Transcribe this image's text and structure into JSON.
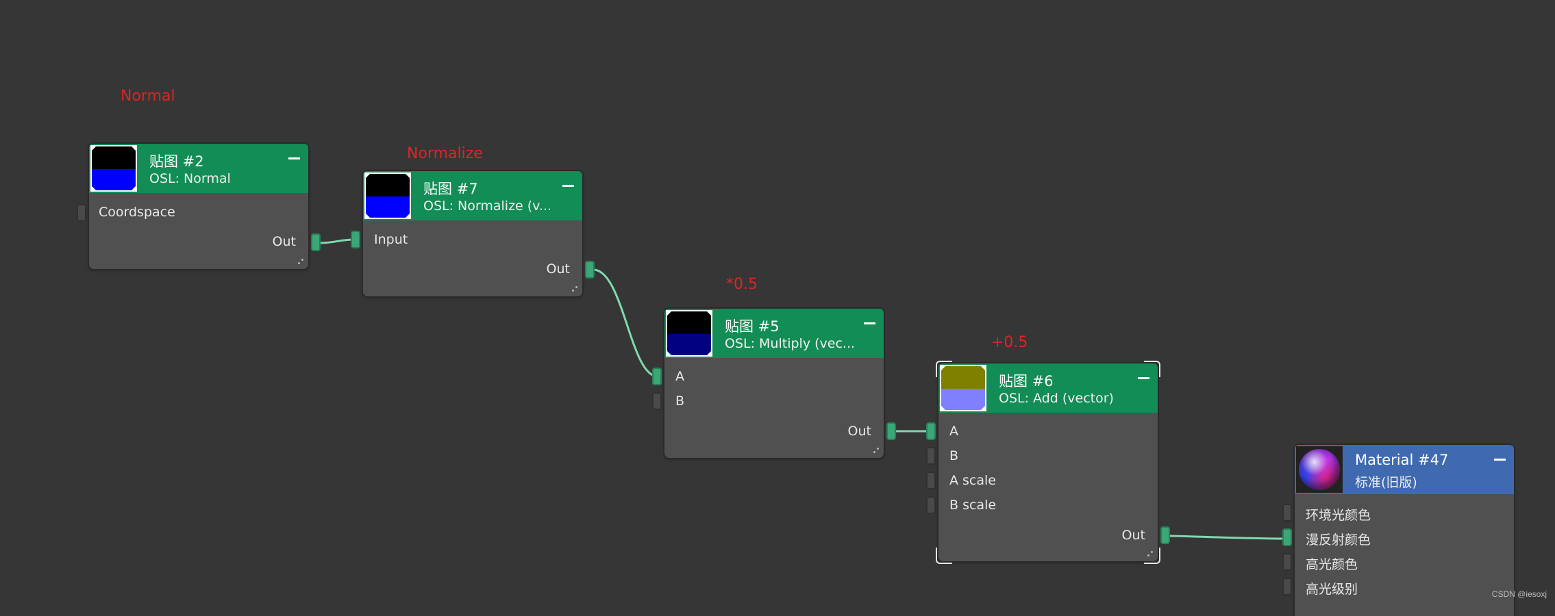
{
  "annotations": {
    "normal": "Normal",
    "normalize": "Normalize",
    "multiply": "*0.5",
    "add": "+0.5"
  },
  "nodes": {
    "map2": {
      "title": "贴图 #2",
      "subtitle": "OSL: Normal",
      "inputs": [
        "Coordspace"
      ],
      "output": "Out",
      "thumb_colors": [
        "#000000",
        "#0000ff"
      ]
    },
    "map7": {
      "title": "贴图 #7",
      "subtitle": "OSL: Normalize (v...",
      "inputs": [
        "Input"
      ],
      "output": "Out",
      "thumb_colors": [
        "#000000",
        "#0000ff"
      ]
    },
    "map5": {
      "title": "贴图 #5",
      "subtitle": "OSL: Multiply (vec...",
      "inputs": [
        "A",
        "B"
      ],
      "output": "Out",
      "thumb_colors": [
        "#000000",
        "#000080"
      ]
    },
    "map6": {
      "title": "贴图 #6",
      "subtitle": "OSL: Add (vector)",
      "inputs": [
        "A",
        "B",
        "A scale",
        "B scale"
      ],
      "output": "Out",
      "thumb_colors": [
        "#808000",
        "#8080ff"
      ]
    },
    "material47": {
      "title": "Material #47",
      "subtitle": "标准(旧版)",
      "inputs": [
        "环境光颜色",
        "漫反射颜色",
        "高光颜色",
        "高光级别"
      ]
    }
  },
  "colors": {
    "canvas": "#363636",
    "node_body": "#505050",
    "map_header": "#128d55",
    "material_header": "#3f6ab0",
    "wire": "#7fd9b0",
    "annotation": "#e02424"
  },
  "watermark": "CSDN @iesoxj"
}
